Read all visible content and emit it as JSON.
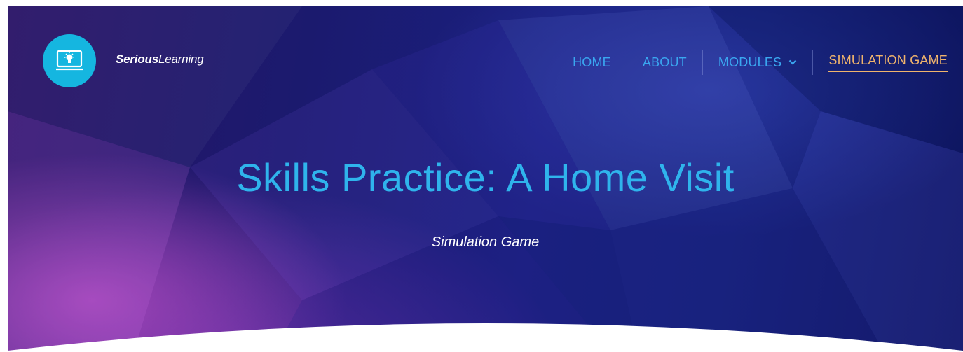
{
  "header": {
    "logo_icon": "monitor-lightbulb-icon",
    "brand_part1": "Serious",
    "brand_part2": "Learning"
  },
  "nav": {
    "items": [
      {
        "label": "HOME",
        "active": false
      },
      {
        "label": "ABOUT",
        "active": false
      },
      {
        "label": "MODULES",
        "active": false,
        "has_dropdown": true
      },
      {
        "label": "SIMULATION GAME",
        "active": true
      }
    ]
  },
  "hero": {
    "title": "Skills Practice: A Home Visit",
    "subtitle": "Simulation Game"
  },
  "colors": {
    "accent_blue": "#2fb4ec",
    "nav_blue": "#3aa7f0",
    "active_orange": "#f0b46c",
    "logo_cyan": "#15b6e0"
  }
}
